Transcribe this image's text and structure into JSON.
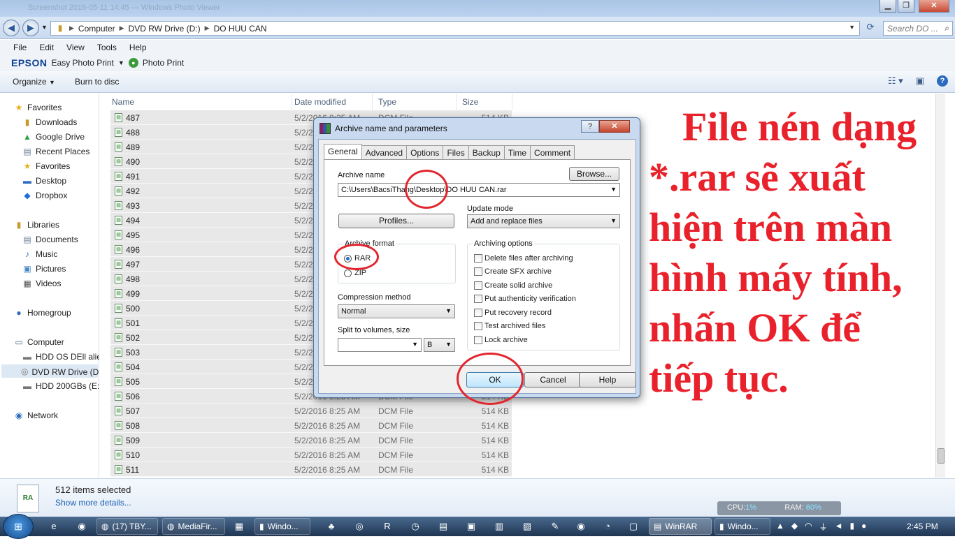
{
  "window": {
    "ghost_title": "Screenshot 2016-05-11 14:45 — Windows Photo Viewer"
  },
  "address": {
    "crumbs": [
      "Computer",
      "DVD RW Drive (D:)",
      "DO HUU CAN"
    ],
    "search_placeholder": "Search DO ..."
  },
  "menu": [
    "File",
    "Edit",
    "View",
    "Tools",
    "Help"
  ],
  "epson": {
    "brand": "EPSON",
    "easy": "Easy Photo Print",
    "photo_print": "Photo Print"
  },
  "commands": {
    "organize": "Organize",
    "burn": "Burn to disc"
  },
  "nav": {
    "favorites": "Favorites",
    "downloads": "Downloads",
    "google_drive": "Google Drive",
    "recent": "Recent Places",
    "favorites2": "Favorites",
    "desktop": "Desktop",
    "dropbox": "Dropbox",
    "libraries": "Libraries",
    "documents": "Documents",
    "music": "Music",
    "pictures": "Pictures",
    "videos": "Videos",
    "homegroup": "Homegroup",
    "computer": "Computer",
    "hdd_os": "HDD OS DEll alien",
    "dvd": "DVD RW Drive (D:)",
    "hdd_e": "HDD 200GBs (E:)",
    "network": "Network"
  },
  "columns": {
    "name": "Name",
    "date": "Date modified",
    "type": "Type",
    "size": "Size"
  },
  "file_common": {
    "date": "5/2/2016 8:25 AM",
    "type": "DCM File",
    "size": "514 KB"
  },
  "files": [
    "487",
    "488",
    "489",
    "490",
    "491",
    "492",
    "493",
    "494",
    "495",
    "496",
    "497",
    "498",
    "499",
    "500",
    "501",
    "502",
    "503",
    "504",
    "505",
    "506",
    "507",
    "508",
    "509",
    "510",
    "511"
  ],
  "details": {
    "count": "512 items selected",
    "more": "Show more details...",
    "cpu_label": "CPU:",
    "cpu": "1%",
    "ram_label": "RAM:",
    "ram": "60%"
  },
  "taskbar": {
    "firefox": "(17) TBY...",
    "mediafire": "MediaFir...",
    "explorer1": "Windo...",
    "winrar": "WinRAR",
    "explorer2": "Windo...",
    "time": "2:45 PM"
  },
  "dialog": {
    "title": "Archive name and parameters",
    "help_btn": "?",
    "close_btn": "✕",
    "tabs": [
      "General",
      "Advanced",
      "Options",
      "Files",
      "Backup",
      "Time",
      "Comment"
    ],
    "archive_name_label": "Archive name",
    "browse": "Browse...",
    "archive_name": "C:\\Users\\BacsiThang\\Desktop\\DO HUU CAN.rar",
    "update_mode_label": "Update mode",
    "profiles": "Profiles...",
    "update_mode": "Add and replace files",
    "format_label": "Archive format",
    "format_rar": "RAR",
    "format_zip": "ZIP",
    "compression_label": "Compression method",
    "compression": "Normal",
    "split_label": "Split to volumes, size",
    "split_value": "",
    "split_unit": "B",
    "options_label": "Archiving options",
    "options": [
      "Delete files after archiving",
      "Create SFX archive",
      "Create solid archive",
      "Put authenticity verification",
      "Put recovery record",
      "Test archived files",
      "Lock archive"
    ],
    "ok": "OK",
    "cancel": "Cancel",
    "help": "Help"
  },
  "annotation": {
    "lines": [
      "File nén dạng",
      "*.rar sẽ xuất",
      "hiện trên màn",
      "hình máy tính,",
      "nhấn OK để",
      "tiếp tục."
    ],
    "color": "#e8212b"
  }
}
